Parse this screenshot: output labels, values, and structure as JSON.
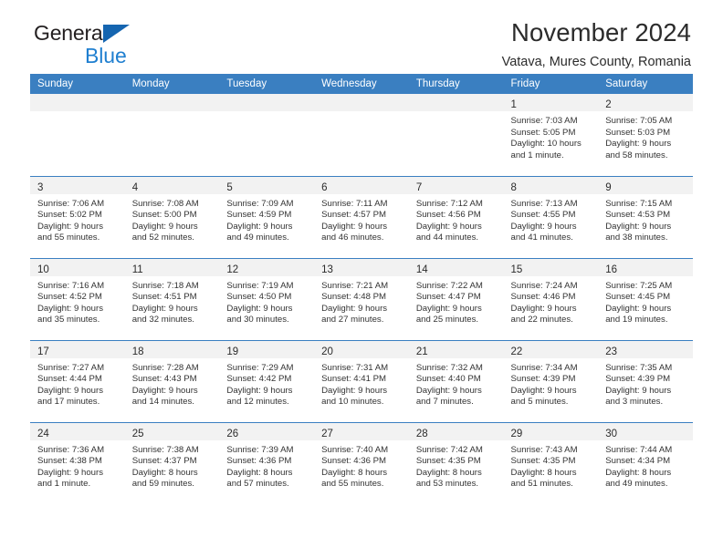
{
  "brand": {
    "name_part1": "General",
    "name_part2": "Blue",
    "color_dark": "#231f20",
    "color_blue": "#1f7fd0",
    "triangle_color": "#1565b0"
  },
  "header": {
    "title": "November 2024",
    "subtitle": "Vatava, Mures County, Romania"
  },
  "theme": {
    "header_bg": "#3a7fc1",
    "daynum_bg": "#f2f2f2",
    "text": "#2b2b2b"
  },
  "weekdays": [
    "Sunday",
    "Monday",
    "Tuesday",
    "Wednesday",
    "Thursday",
    "Friday",
    "Saturday"
  ],
  "labels": {
    "sunrise": "Sunrise:",
    "sunset": "Sunset:",
    "daylight": "Daylight:"
  },
  "weeks": [
    [
      {
        "day": "",
        "l1": "",
        "l2": "",
        "l3": "",
        "l4": ""
      },
      {
        "day": "",
        "l1": "",
        "l2": "",
        "l3": "",
        "l4": ""
      },
      {
        "day": "",
        "l1": "",
        "l2": "",
        "l3": "",
        "l4": ""
      },
      {
        "day": "",
        "l1": "",
        "l2": "",
        "l3": "",
        "l4": ""
      },
      {
        "day": "",
        "l1": "",
        "l2": "",
        "l3": "",
        "l4": ""
      },
      {
        "day": "1",
        "l1": "Sunrise: 7:03 AM",
        "l2": "Sunset: 5:05 PM",
        "l3": "Daylight: 10 hours",
        "l4": "and 1 minute."
      },
      {
        "day": "2",
        "l1": "Sunrise: 7:05 AM",
        "l2": "Sunset: 5:03 PM",
        "l3": "Daylight: 9 hours",
        "l4": "and 58 minutes."
      }
    ],
    [
      {
        "day": "3",
        "l1": "Sunrise: 7:06 AM",
        "l2": "Sunset: 5:02 PM",
        "l3": "Daylight: 9 hours",
        "l4": "and 55 minutes."
      },
      {
        "day": "4",
        "l1": "Sunrise: 7:08 AM",
        "l2": "Sunset: 5:00 PM",
        "l3": "Daylight: 9 hours",
        "l4": "and 52 minutes."
      },
      {
        "day": "5",
        "l1": "Sunrise: 7:09 AM",
        "l2": "Sunset: 4:59 PM",
        "l3": "Daylight: 9 hours",
        "l4": "and 49 minutes."
      },
      {
        "day": "6",
        "l1": "Sunrise: 7:11 AM",
        "l2": "Sunset: 4:57 PM",
        "l3": "Daylight: 9 hours",
        "l4": "and 46 minutes."
      },
      {
        "day": "7",
        "l1": "Sunrise: 7:12 AM",
        "l2": "Sunset: 4:56 PM",
        "l3": "Daylight: 9 hours",
        "l4": "and 44 minutes."
      },
      {
        "day": "8",
        "l1": "Sunrise: 7:13 AM",
        "l2": "Sunset: 4:55 PM",
        "l3": "Daylight: 9 hours",
        "l4": "and 41 minutes."
      },
      {
        "day": "9",
        "l1": "Sunrise: 7:15 AM",
        "l2": "Sunset: 4:53 PM",
        "l3": "Daylight: 9 hours",
        "l4": "and 38 minutes."
      }
    ],
    [
      {
        "day": "10",
        "l1": "Sunrise: 7:16 AM",
        "l2": "Sunset: 4:52 PM",
        "l3": "Daylight: 9 hours",
        "l4": "and 35 minutes."
      },
      {
        "day": "11",
        "l1": "Sunrise: 7:18 AM",
        "l2": "Sunset: 4:51 PM",
        "l3": "Daylight: 9 hours",
        "l4": "and 32 minutes."
      },
      {
        "day": "12",
        "l1": "Sunrise: 7:19 AM",
        "l2": "Sunset: 4:50 PM",
        "l3": "Daylight: 9 hours",
        "l4": "and 30 minutes."
      },
      {
        "day": "13",
        "l1": "Sunrise: 7:21 AM",
        "l2": "Sunset: 4:48 PM",
        "l3": "Daylight: 9 hours",
        "l4": "and 27 minutes."
      },
      {
        "day": "14",
        "l1": "Sunrise: 7:22 AM",
        "l2": "Sunset: 4:47 PM",
        "l3": "Daylight: 9 hours",
        "l4": "and 25 minutes."
      },
      {
        "day": "15",
        "l1": "Sunrise: 7:24 AM",
        "l2": "Sunset: 4:46 PM",
        "l3": "Daylight: 9 hours",
        "l4": "and 22 minutes."
      },
      {
        "day": "16",
        "l1": "Sunrise: 7:25 AM",
        "l2": "Sunset: 4:45 PM",
        "l3": "Daylight: 9 hours",
        "l4": "and 19 minutes."
      }
    ],
    [
      {
        "day": "17",
        "l1": "Sunrise: 7:27 AM",
        "l2": "Sunset: 4:44 PM",
        "l3": "Daylight: 9 hours",
        "l4": "and 17 minutes."
      },
      {
        "day": "18",
        "l1": "Sunrise: 7:28 AM",
        "l2": "Sunset: 4:43 PM",
        "l3": "Daylight: 9 hours",
        "l4": "and 14 minutes."
      },
      {
        "day": "19",
        "l1": "Sunrise: 7:29 AM",
        "l2": "Sunset: 4:42 PM",
        "l3": "Daylight: 9 hours",
        "l4": "and 12 minutes."
      },
      {
        "day": "20",
        "l1": "Sunrise: 7:31 AM",
        "l2": "Sunset: 4:41 PM",
        "l3": "Daylight: 9 hours",
        "l4": "and 10 minutes."
      },
      {
        "day": "21",
        "l1": "Sunrise: 7:32 AM",
        "l2": "Sunset: 4:40 PM",
        "l3": "Daylight: 9 hours",
        "l4": "and 7 minutes."
      },
      {
        "day": "22",
        "l1": "Sunrise: 7:34 AM",
        "l2": "Sunset: 4:39 PM",
        "l3": "Daylight: 9 hours",
        "l4": "and 5 minutes."
      },
      {
        "day": "23",
        "l1": "Sunrise: 7:35 AM",
        "l2": "Sunset: 4:39 PM",
        "l3": "Daylight: 9 hours",
        "l4": "and 3 minutes."
      }
    ],
    [
      {
        "day": "24",
        "l1": "Sunrise: 7:36 AM",
        "l2": "Sunset: 4:38 PM",
        "l3": "Daylight: 9 hours",
        "l4": "and 1 minute."
      },
      {
        "day": "25",
        "l1": "Sunrise: 7:38 AM",
        "l2": "Sunset: 4:37 PM",
        "l3": "Daylight: 8 hours",
        "l4": "and 59 minutes."
      },
      {
        "day": "26",
        "l1": "Sunrise: 7:39 AM",
        "l2": "Sunset: 4:36 PM",
        "l3": "Daylight: 8 hours",
        "l4": "and 57 minutes."
      },
      {
        "day": "27",
        "l1": "Sunrise: 7:40 AM",
        "l2": "Sunset: 4:36 PM",
        "l3": "Daylight: 8 hours",
        "l4": "and 55 minutes."
      },
      {
        "day": "28",
        "l1": "Sunrise: 7:42 AM",
        "l2": "Sunset: 4:35 PM",
        "l3": "Daylight: 8 hours",
        "l4": "and 53 minutes."
      },
      {
        "day": "29",
        "l1": "Sunrise: 7:43 AM",
        "l2": "Sunset: 4:35 PM",
        "l3": "Daylight: 8 hours",
        "l4": "and 51 minutes."
      },
      {
        "day": "30",
        "l1": "Sunrise: 7:44 AM",
        "l2": "Sunset: 4:34 PM",
        "l3": "Daylight: 8 hours",
        "l4": "and 49 minutes."
      }
    ]
  ]
}
